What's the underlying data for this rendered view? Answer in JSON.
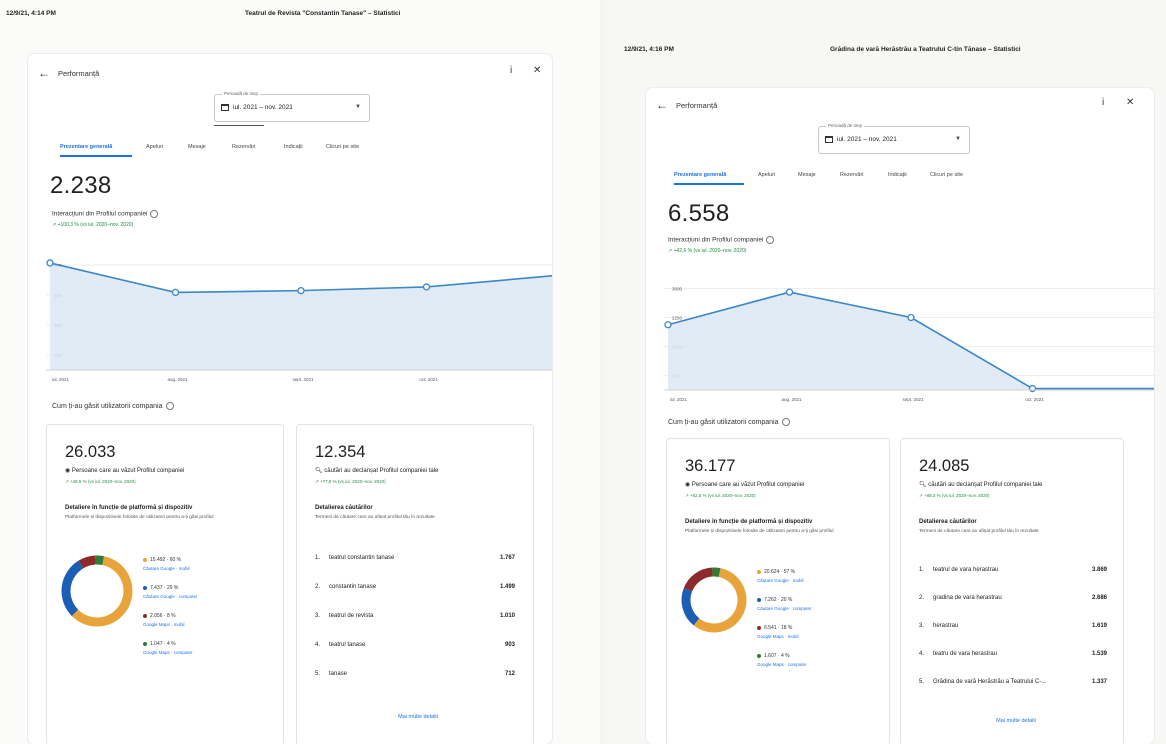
{
  "left": {
    "print_time": "12/9/21, 4:14 PM",
    "print_title": "Teatrul de Revista \"Constantin Tanase\" – Statistici",
    "header_title": "Performanță",
    "period_label": "Perioadă de timp",
    "period_value": "iul. 2021 – nov. 2021",
    "tabs": [
      "Prezentare generală",
      "Apeluri",
      "Mesaje",
      "Rezervări",
      "Indicații",
      "Clicuri pe site"
    ],
    "interactions_total": "2.238",
    "interactions_label": "Interacțiuni din Profilul companiei",
    "interactions_trend": "+100,3 % (vs iul. 2020–nov. 2020)",
    "chart_data": {
      "type": "area",
      "x": [
        "iul. 2021",
        "aug. 2021",
        "sept. 2021",
        "oct. 2021",
        "nov. 2021"
      ],
      "values": [
        580,
        420,
        430,
        450,
        510
      ],
      "yticks": [
        "600",
        "450",
        "300",
        "150"
      ],
      "xticks": [
        "iul. 2021",
        "aug. 2021",
        "sept. 2021",
        "oct. 2021"
      ],
      "ylim": [
        0,
        650
      ]
    },
    "found_title": "Cum ți-au găsit utilizatorii compania",
    "views": {
      "total": "26.033",
      "label": "Persoane care au văzut Profilul companiei",
      "trend": "+48,5 % (vs iul. 2020–nov. 2020)",
      "detail_title": "Detaliere în funcție de platformă și dispozitiv",
      "detail_desc": "Platformele și dispozitivele folosite de utilizatori pentru a-ți găsi profilul",
      "donut": [
        {
          "label": "15.492 · 60 %",
          "source": "Căutare Google · mobil",
          "value": 60,
          "color": "#e8a33a"
        },
        {
          "label": "7.437 · 29 %",
          "source": "Căutare Google · computer",
          "value": 29,
          "color": "#1a5fb4"
        },
        {
          "label": "2.056 · 8 %",
          "source": "Google Maps · mobil",
          "value": 8,
          "color": "#8b2b2b"
        },
        {
          "label": "1.047 · 4 %",
          "source": "Google Maps · computer",
          "value": 4,
          "color": "#2e7d32"
        }
      ]
    },
    "searches": {
      "total": "12.354",
      "label": "căutări au declanșat Profilul companiei tale",
      "trend": "+77,8 % (vs iul. 2020–nov. 2020)",
      "detail_title": "Detalierea căutărilor",
      "detail_desc": "Termeni de căutare care au afișat profilul tău în rezultate",
      "rows": [
        {
          "idx": "1.",
          "term": "teatrul constantin tanase",
          "count": "1.767"
        },
        {
          "idx": "2.",
          "term": "constantin tanase",
          "count": "1.499"
        },
        {
          "idx": "3.",
          "term": "teatrul de revista",
          "count": "1.010"
        },
        {
          "idx": "4.",
          "term": "teatrul tanase",
          "count": "903"
        },
        {
          "idx": "5.",
          "term": "tanase",
          "count": "712"
        }
      ],
      "more": "Mai multe detalii"
    }
  },
  "right": {
    "print_time": "12/9/21, 4:16 PM",
    "print_title": "Grădina de vară Herăstrău a Teatrului C-tin Tănase – Statistici",
    "header_title": "Performanță",
    "period_label": "Perioadă de timp",
    "period_value": "iul. 2021 – nov. 2021",
    "tabs": [
      "Prezentare generală",
      "Apeluri",
      "Mesaje",
      "Rezervări",
      "Indicații",
      "Clicuri pe site"
    ],
    "interactions_total": "6.558",
    "interactions_label": "Interacțiuni din Profilul companiei",
    "interactions_trend": "+42,6 % (vs iul. 2020–nov. 2020)",
    "chart_data": {
      "type": "area",
      "x": [
        "iul. 2021",
        "aug. 2021",
        "sept. 2021",
        "oct. 2021",
        "nov. 2021"
      ],
      "values": [
        1800,
        2700,
        2000,
        40,
        40
      ],
      "yticks": [
        "3000",
        "2250",
        "1500",
        "750"
      ],
      "xticks": [
        "iul. 2021",
        "aug. 2021",
        "sept. 2021",
        "oct. 2021"
      ],
      "ylim": [
        0,
        3200
      ]
    },
    "found_title": "Cum ți-au găsit utilizatorii compania",
    "views": {
      "total": "36.177",
      "label": "Persoane care au văzut Profilul companiei",
      "trend": "+62,5 % (vs iul. 2020–nov. 2020)",
      "detail_title": "Detaliere în funcție de platformă și dispozitiv",
      "detail_desc": "Platformele și dispozitivele folosite de utilizatori pentru a-ți găsi profilul",
      "donut": [
        {
          "label": "20.624 · 57 %",
          "source": "Căutare Google · mobil",
          "value": 57,
          "color": "#e8a33a"
        },
        {
          "label": "7.262 · 20 %",
          "source": "Căutare Google · computer",
          "value": 20,
          "color": "#1a5fb4"
        },
        {
          "label": "6.541 · 18 %",
          "source": "Google Maps · mobil",
          "value": 18,
          "color": "#8b2b2b"
        },
        {
          "label": "1.607 · 4 %",
          "source": "Google Maps · computer",
          "value": 4,
          "color": "#2e7d32"
        }
      ]
    },
    "searches": {
      "total": "24.085",
      "label": "căutări au declanșat Profilul companiei tale",
      "trend": "+88,3 % (vs iul. 2020–nov. 2020)",
      "detail_title": "Detalierea căutărilor",
      "detail_desc": "Termeni de căutare care au afișat profilul tău în rezultate",
      "rows": [
        {
          "idx": "1.",
          "term": "teatrul de vara herastrau",
          "count": "3.869"
        },
        {
          "idx": "2.",
          "term": "gradina de vara herastrau",
          "count": "2.686"
        },
        {
          "idx": "3.",
          "term": "herastrau",
          "count": "1.619"
        },
        {
          "idx": "4.",
          "term": "teatru de vara herastrau",
          "count": "1.539"
        },
        {
          "idx": "5.",
          "term": "Grădina de vară Herăstrău a Teatrului C-...",
          "count": "1.337"
        }
      ],
      "more": "Mai multe detalii"
    }
  }
}
